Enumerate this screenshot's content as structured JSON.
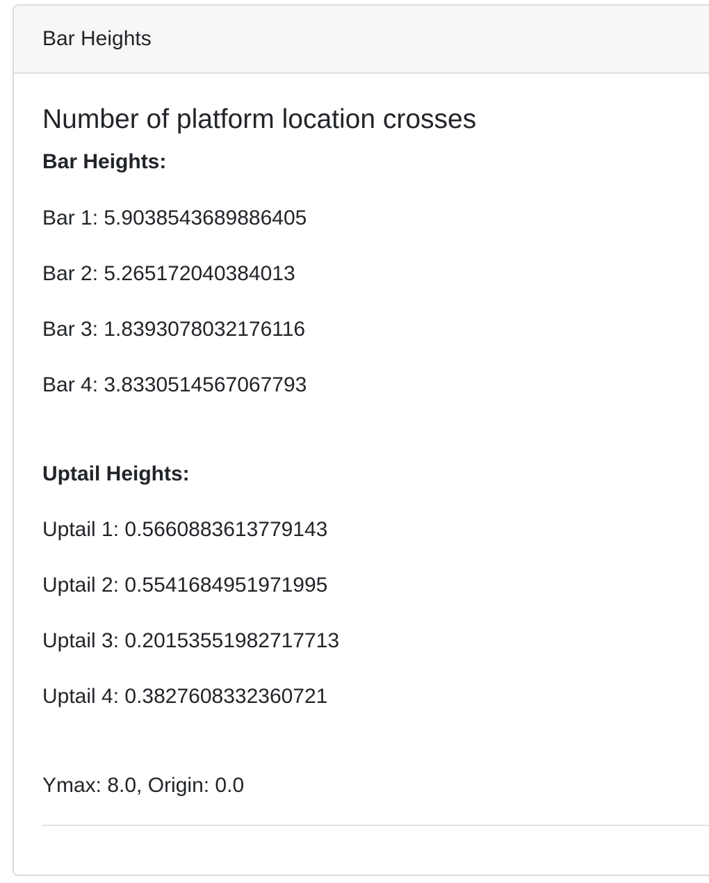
{
  "card": {
    "header": "Bar Heights",
    "title": "Number of platform location crosses",
    "bar_heights": {
      "heading": "Bar Heights:",
      "items": [
        "Bar 1: 5.9038543689886405",
        "Bar 2: 5.265172040384013",
        "Bar 3: 1.8393078032176116",
        "Bar 4: 3.8330514567067793"
      ]
    },
    "uptail_heights": {
      "heading": "Uptail Heights:",
      "items": [
        "Uptail 1: 0.5660883613779143",
        "Uptail 2: 0.5541684951971995",
        "Uptail 3: 0.20153551982717713",
        "Uptail 4: 0.3827608332360721"
      ]
    },
    "footer": "Ymax: 8.0, Origin: 0.0"
  }
}
